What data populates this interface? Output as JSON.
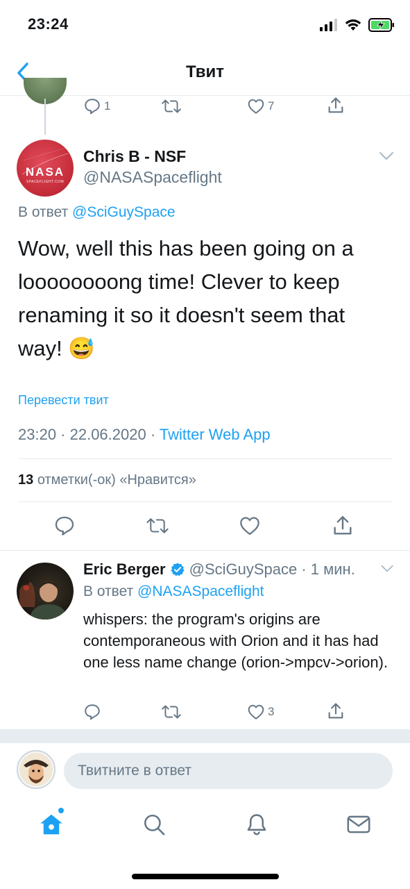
{
  "status_bar": {
    "time": "23:24"
  },
  "nav": {
    "title": "Твит"
  },
  "prev_tweet": {
    "reply_count": "1",
    "retweet_count": "",
    "like_count": "7"
  },
  "main_tweet": {
    "name": "Chris B - NSF",
    "handle": "@NASASpaceflight",
    "reply_prefix": "В ответ",
    "reply_to": "@SciGuySpace",
    "text": "Wow, well this has been going on a loooooooong time! Clever to keep renaming it so it doesn't seem that way!",
    "emoji": "😅",
    "translate": "Перевести твит",
    "timestamp": "23:20 · 22.06.2020 · ",
    "source": "Twitter Web App",
    "likes_count": "13",
    "likes_label": "отметки(-ок) «Нравится»"
  },
  "reply_tweet": {
    "name": "Eric Berger",
    "handle_time": "@SciGuySpace · 1 мин.",
    "reply_prefix": "В ответ",
    "reply_to": "@NASASpaceflight",
    "text": "whispers: the program's origins are contemporaneous with Orion and it has had one less name change (orion->mpcv->orion).",
    "like_count": "3"
  },
  "compose": {
    "placeholder": "Твитните в ответ"
  },
  "colors": {
    "accent": "#1da1f2",
    "muted": "#657786",
    "divider": "#e6ecf0"
  }
}
